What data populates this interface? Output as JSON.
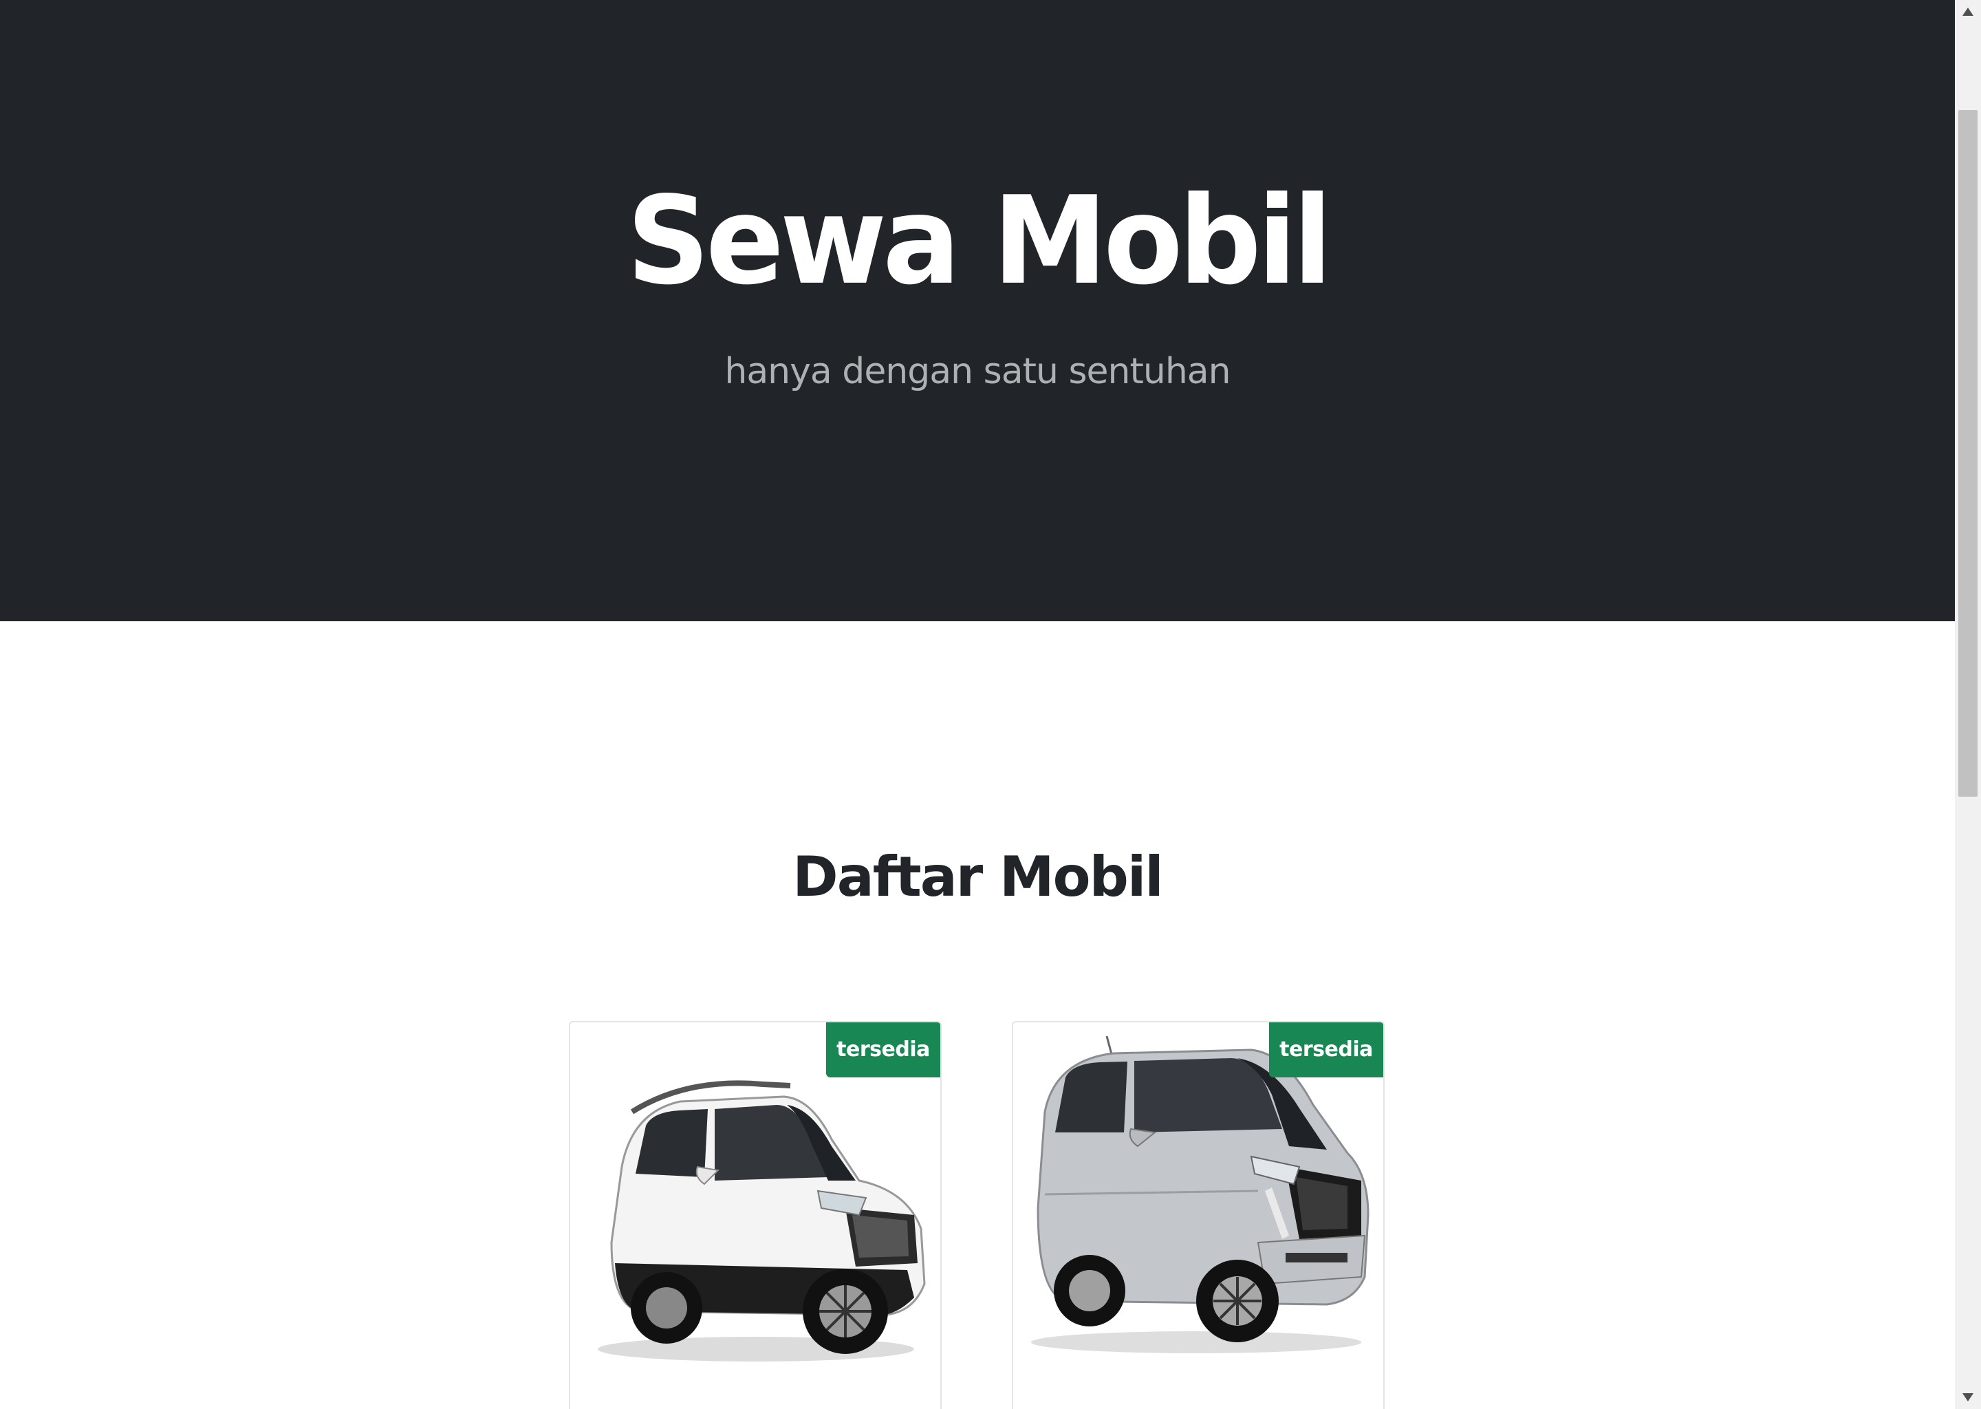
{
  "hero": {
    "title": "Sewa Mobil",
    "subtitle": "hanya dengan satu sentuhan",
    "background_color": "#212529"
  },
  "section": {
    "title": "Daftar Mobil"
  },
  "cars": [
    {
      "status": "tersedia",
      "image_icon": "white-suv-car-image",
      "color": "#f2f2f2"
    },
    {
      "status": "tersedia",
      "image_icon": "silver-mpv-car-image",
      "color": "#b9bcc0"
    }
  ],
  "colors": {
    "badge_green": "#198754",
    "scrollbar_track": "#f1f1f1",
    "scrollbar_thumb": "#c1c1c1"
  }
}
